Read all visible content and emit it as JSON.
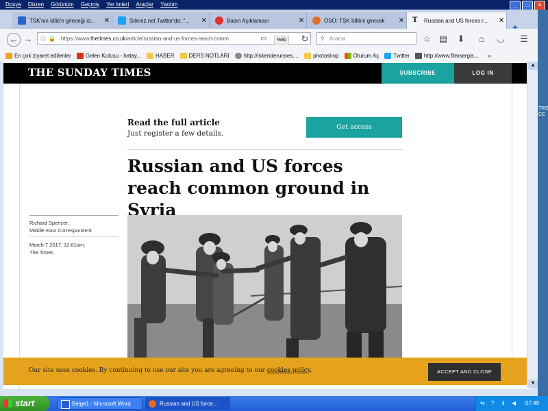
{
  "menubar": {
    "items": [
      "Dosya",
      "Düzen",
      "Görünüm",
      "Geçmiş",
      "Yer imleri",
      "Araçlar",
      "Yardım"
    ]
  },
  "tabs": [
    {
      "label": "TSK'nin İdlib'e gireceği id...",
      "color": "#2b63c9"
    },
    {
      "label": "Sdeniz.net Twitter'da: \"...",
      "color": "#1da1f2"
    },
    {
      "label": "Basın Açıklaması",
      "color": "#e03030"
    },
    {
      "label": "ÖSO: TSK İdlib'e girecek",
      "color": "#e07030"
    },
    {
      "label": "Russian and US forces r...",
      "color": "#222222"
    }
  ],
  "url": {
    "prefix": "https://www.",
    "domain": "thetimes.co.uk",
    "path": "/article/russian-and-us-forces-reach-comm",
    "zoom": "%90"
  },
  "search": {
    "placeholder": "Arama"
  },
  "bookmarks": [
    {
      "label": "En çok ziyaret edilenler",
      "color": "#f2a12a"
    },
    {
      "label": "Gelen Kutusu - hatay...",
      "color": "#d93025"
    },
    {
      "label": "HABER",
      "color": "#f2c94c"
    },
    {
      "label": "DERS NOTLARI",
      "color": "#f2c94c"
    },
    {
      "label": "http://iskenderunses....",
      "color": "#888888"
    },
    {
      "label": "photoshop",
      "color": "#f2c94c"
    },
    {
      "label": "Oturum Aç",
      "color": "#f25022"
    },
    {
      "label": "Twitter",
      "color": "#1da1f2"
    },
    {
      "label": "http://www.filmsergis...",
      "color": "#555555"
    }
  ],
  "site": {
    "logo": "THE SUNDAY TIMES",
    "subscribe": "SUBSCRIBE",
    "login": "LOG IN",
    "register_title": "Read the full article",
    "register_sub": "Just register a few details.",
    "get_access": "Get access",
    "headline": "Russian and US forces reach common ground in Syria",
    "author": "Richard Spencer,",
    "author_role": "Middle East Correspondent",
    "date": "March 7 2017, 12:01am,",
    "source": "The Times",
    "cookie_text": "Our site uses cookies. By continuing to use our site you are agreeing to our ",
    "cookie_link": "cookies policy",
    "cookie_end": ".",
    "accept": "ACCEPT AND CLOSE"
  },
  "taskbar": {
    "start": "start",
    "buttons": [
      "Belge1 - Microsoft Word",
      "Russian and US force..."
    ],
    "clock": "07:49"
  },
  "side_label": "TRO\nCE"
}
